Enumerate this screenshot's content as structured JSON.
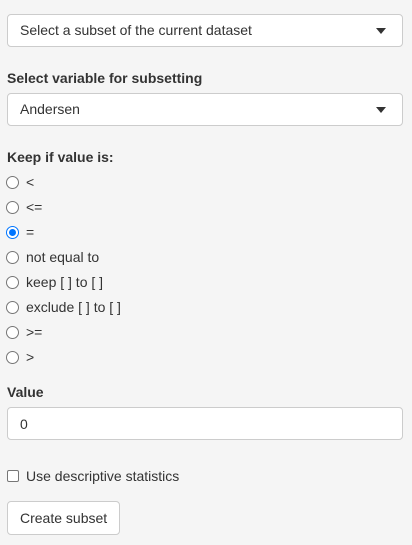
{
  "dataset_select": {
    "value": "Select a subset of the current dataset"
  },
  "variable_section": {
    "label": "Select variable for subsetting",
    "value": "Andersen"
  },
  "keep_section": {
    "label": "Keep if value is:",
    "options": [
      {
        "label": "<",
        "checked": false
      },
      {
        "label": "<=",
        "checked": false
      },
      {
        "label": "=",
        "checked": true
      },
      {
        "label": "not equal to",
        "checked": false
      },
      {
        "label": "keep [ ] to [ ]",
        "checked": false
      },
      {
        "label": "exclude [ ] to [ ]",
        "checked": false
      },
      {
        "label": ">=",
        "checked": false
      },
      {
        "label": ">",
        "checked": false
      }
    ]
  },
  "value_section": {
    "label": "Value",
    "value": "0"
  },
  "descriptive_stats": {
    "label": "Use descriptive statistics",
    "checked": false
  },
  "create_button": {
    "label": "Create subset"
  },
  "colors": {
    "background": "#f5f5f5",
    "accent": "#0075ff",
    "border": "#cccccc",
    "text": "#333333"
  }
}
